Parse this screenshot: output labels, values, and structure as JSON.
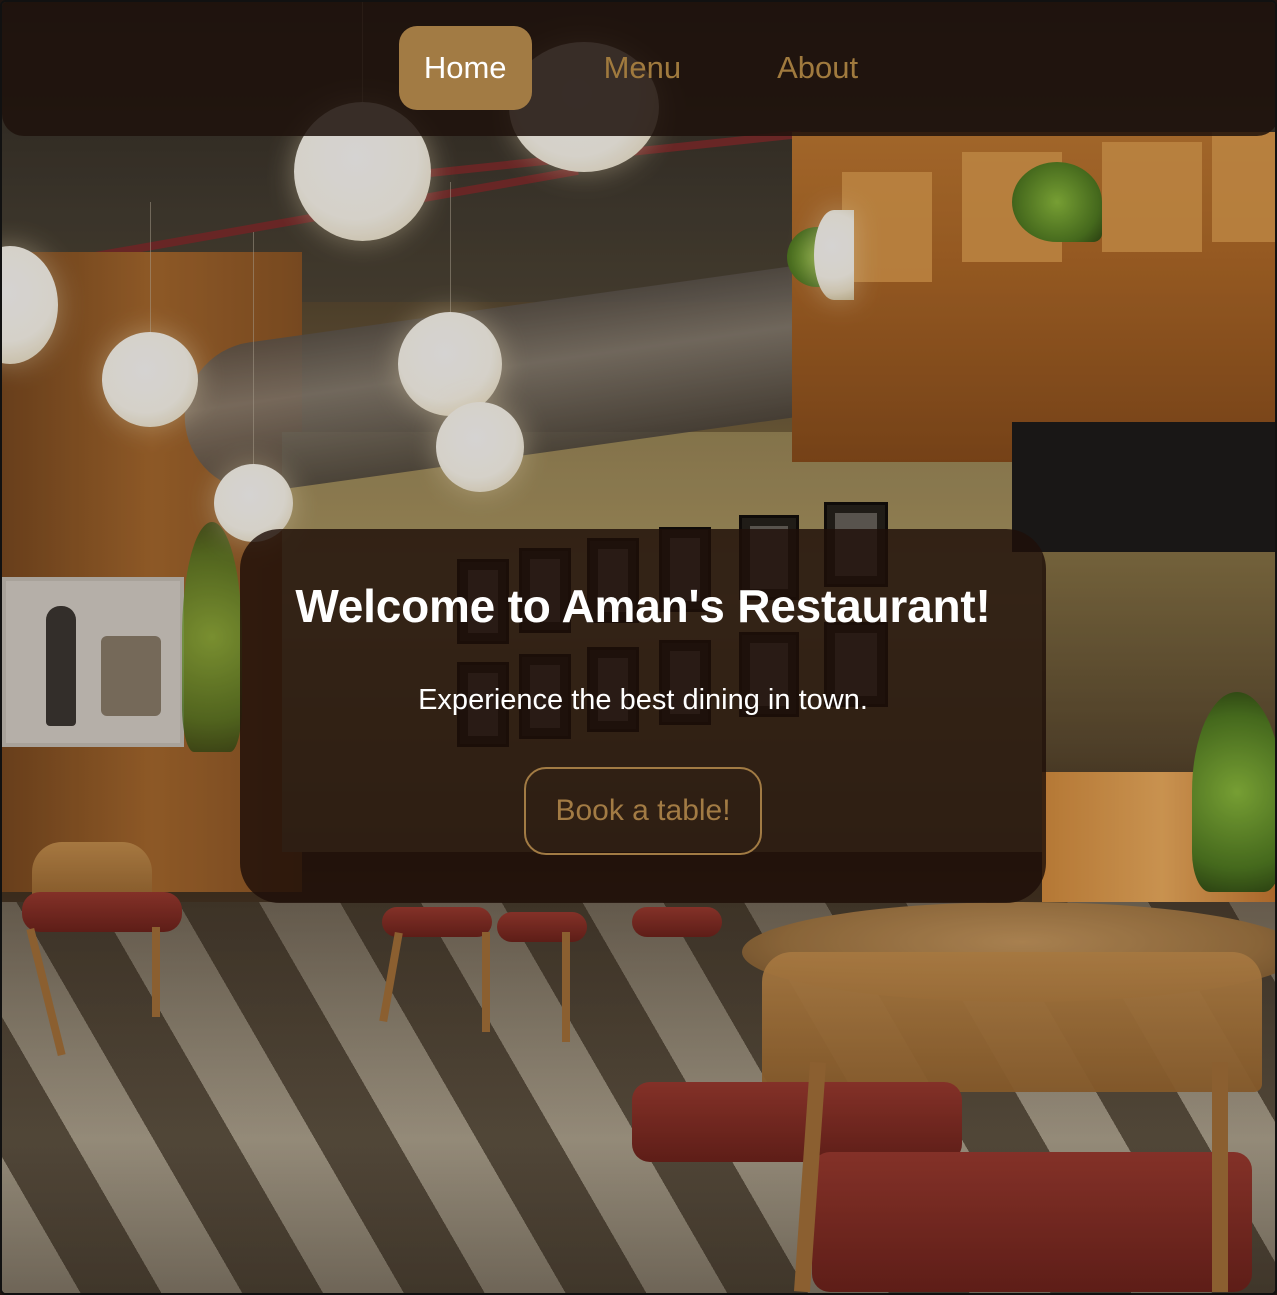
{
  "nav": {
    "items": [
      {
        "label": "Home",
        "active": true
      },
      {
        "label": "Menu",
        "active": false
      },
      {
        "label": "About",
        "active": false
      }
    ]
  },
  "hero": {
    "title": "Welcome to Aman's Restaurant!",
    "subtitle": "Experience the best dining in town.",
    "cta_label": "Book a table!"
  },
  "colors": {
    "accent": "#a27b44",
    "nav_bg": "#1e120c",
    "hero_bg": "#1e0f08",
    "text_light": "#ffffff"
  },
  "background_image": {
    "description_icon": "restaurant-interior-photo"
  }
}
